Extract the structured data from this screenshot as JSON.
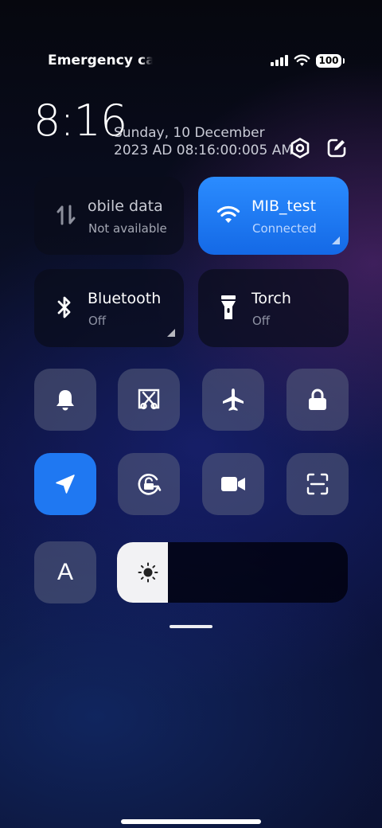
{
  "status_bar": {
    "left_text": "Emergency calls",
    "battery_level": "100",
    "signal_icon": "signal-bars-icon",
    "wifi_icon": "wifi-icon"
  },
  "header": {
    "time": "8:16",
    "date_line_1": "Sunday, 10 December",
    "date_line_2": "2023 AD 08:16:00:005 AM",
    "settings_icon": "settings-hexagon-icon",
    "edit_icon": "edit-icon"
  },
  "tiles": {
    "mobile_data": {
      "title": "obile data",
      "subtitle": "Not available",
      "icon": "mobile-data-arrows-icon"
    },
    "wifi": {
      "title": "MIB_test",
      "subtitle": "Connected",
      "icon": "wifi-icon"
    },
    "bluetooth": {
      "title": "Bluetooth",
      "subtitle": "Off",
      "icon": "bluetooth-icon"
    },
    "torch": {
      "title": "Torch",
      "subtitle": "Off",
      "icon": "flashlight-icon"
    }
  },
  "quick_toggles": [
    {
      "name": "bell-icon",
      "active": false
    },
    {
      "name": "screenshot-scissors-icon",
      "active": false
    },
    {
      "name": "airplane-icon",
      "active": false
    },
    {
      "name": "lock-icon",
      "active": false
    },
    {
      "name": "location-arrow-icon",
      "active": true
    },
    {
      "name": "rotation-lock-icon",
      "active": false
    },
    {
      "name": "video-camera-icon",
      "active": false
    },
    {
      "name": "scan-icon",
      "active": false
    }
  ],
  "reading_mode": {
    "label": "A",
    "icon": "font-a-icon"
  },
  "brightness": {
    "level": 0.22,
    "icon": "sun-icon"
  },
  "colors": {
    "accent": "#1f78f2",
    "tile_dark": "#0a0c1a",
    "button": "#5a607d"
  }
}
